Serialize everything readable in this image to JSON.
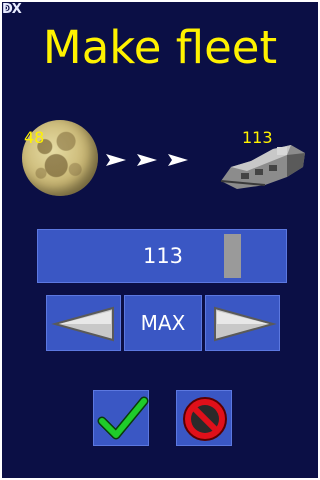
{
  "corner_mark": "ↁX",
  "title": "Make fleet",
  "planet": {
    "count": "48",
    "icon": "moon-icon"
  },
  "fleet": {
    "count": "113",
    "icon": "spaceship-icon"
  },
  "slider": {
    "value": "113",
    "fraction": 1.0
  },
  "controls": {
    "decrease_icon": "left-arrow-icon",
    "max_label": "MAX",
    "increase_icon": "right-arrow-icon"
  },
  "actions": {
    "confirm_icon": "checkmark-icon",
    "cancel_icon": "cancel-icon"
  },
  "colors": {
    "background": "#0b0f45",
    "accent_text": "#fff200",
    "button": "#3a57c4",
    "check": "#1fcc2a",
    "cancel": "#e0101a"
  }
}
